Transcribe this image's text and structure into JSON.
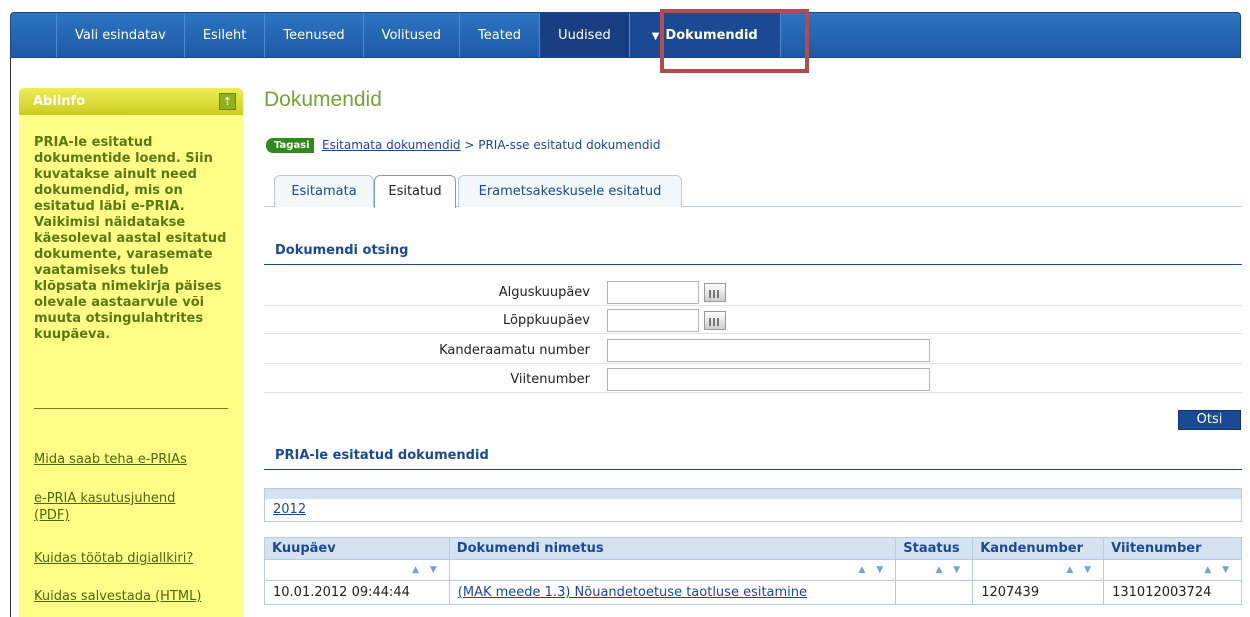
{
  "nav": {
    "items": [
      {
        "label": "Vali esindatav"
      },
      {
        "label": "Esileht"
      },
      {
        "label": "Teenused"
      },
      {
        "label": "Volitused"
      },
      {
        "label": "Teated"
      },
      {
        "label": "Uudised"
      },
      {
        "label": "Dokumendid"
      }
    ],
    "active_arrow": "▼"
  },
  "sidebar": {
    "title": "Abiinfo",
    "collapse_icon": "⇡",
    "help_text": "PRIA-le esitatud dokumentide loend. Siin kuvatakse ainult need dokumendid, mis on esitatud läbi e-PRIA. Vaikimisi näidatakse käesoleval aastal esitatud dokumente, varasemate vaatamiseks tuleb klõpsata nimekirja päises olevale aastaarvule või muuta otsingulahtrites kuupäeva.",
    "links": [
      "Mida saab teha e-PRIAs",
      "e-PRIA kasutusjuhend (PDF)",
      "Kuidas töötab digiallkiri?",
      "Kuidas salvestada (HTML)"
    ]
  },
  "main": {
    "title": "Dokumendid",
    "back_label": "Tagasi",
    "breadcrumb_link": "Esitamata dokumendid",
    "breadcrumb_rest": " > PRIA-sse esitatud dokumendid",
    "tabs": [
      {
        "label": "Esitamata"
      },
      {
        "label": "Esitatud"
      },
      {
        "label": "Erametsakeskusele esitatud"
      }
    ],
    "active_tab": "Esitatud",
    "search": {
      "heading": "Dokumendi otsing",
      "fields": [
        {
          "label": "Alguskuupäev",
          "value": ""
        },
        {
          "label": "Lõppkuupäev",
          "value": ""
        },
        {
          "label": "Kanderaamatu number",
          "value": ""
        },
        {
          "label": "Viitenumber",
          "value": ""
        }
      ],
      "button": "Otsi"
    },
    "list": {
      "heading": "PRIA-le esitatud dokumendid",
      "year": "2012",
      "columns": [
        "Kuupäev",
        "Dokumendi nimetus",
        "Staatus",
        "Kandenumber",
        "Viitenumber"
      ],
      "sort_icon": "▲ ▼",
      "rows": [
        {
          "date": "10.01.2012 09:44:44",
          "name": "(MAK meede 1.3) Nõuandetoetuse taotluse esitamine",
          "status": "",
          "entry_number": "1207439",
          "reference": "131012003724"
        }
      ]
    }
  }
}
